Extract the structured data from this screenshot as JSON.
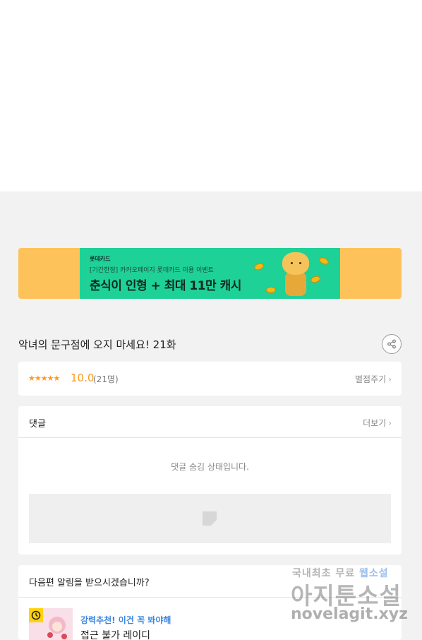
{
  "banner": {
    "brand": "롯데카드",
    "sub": "[기간한정] 카카오페이지 롯데카드 이용 이벤트",
    "main": "춘식이 인형 + 최대 11만 캐시",
    "colors": {
      "outer": "#fdc35a",
      "inner": "#1ed197"
    }
  },
  "episode": {
    "title": "악녀의 문구점에 오지 마세요! 21화",
    "share_icon": "share-icon"
  },
  "rating": {
    "stars": "★★★★★",
    "score": "10.0",
    "count": "(21명)",
    "rate_label": "별점주기",
    "accent_color": "#ff9a1b"
  },
  "comments": {
    "label": "댓글",
    "more_label": "더보기",
    "hidden_message": "댓글 숨김 상태입니다."
  },
  "next": {
    "question": "다음편 알림을 받으시겠습니까?",
    "rec_tag": "강력추천! 이건 꼭 봐야해",
    "rec_title": "접근 불가 레이디"
  },
  "watermark": {
    "line1": "국내최초 무료",
    "line1_blue": "웹소설",
    "line2": "아지툰소설",
    "line3": "novelagit.xyz"
  }
}
